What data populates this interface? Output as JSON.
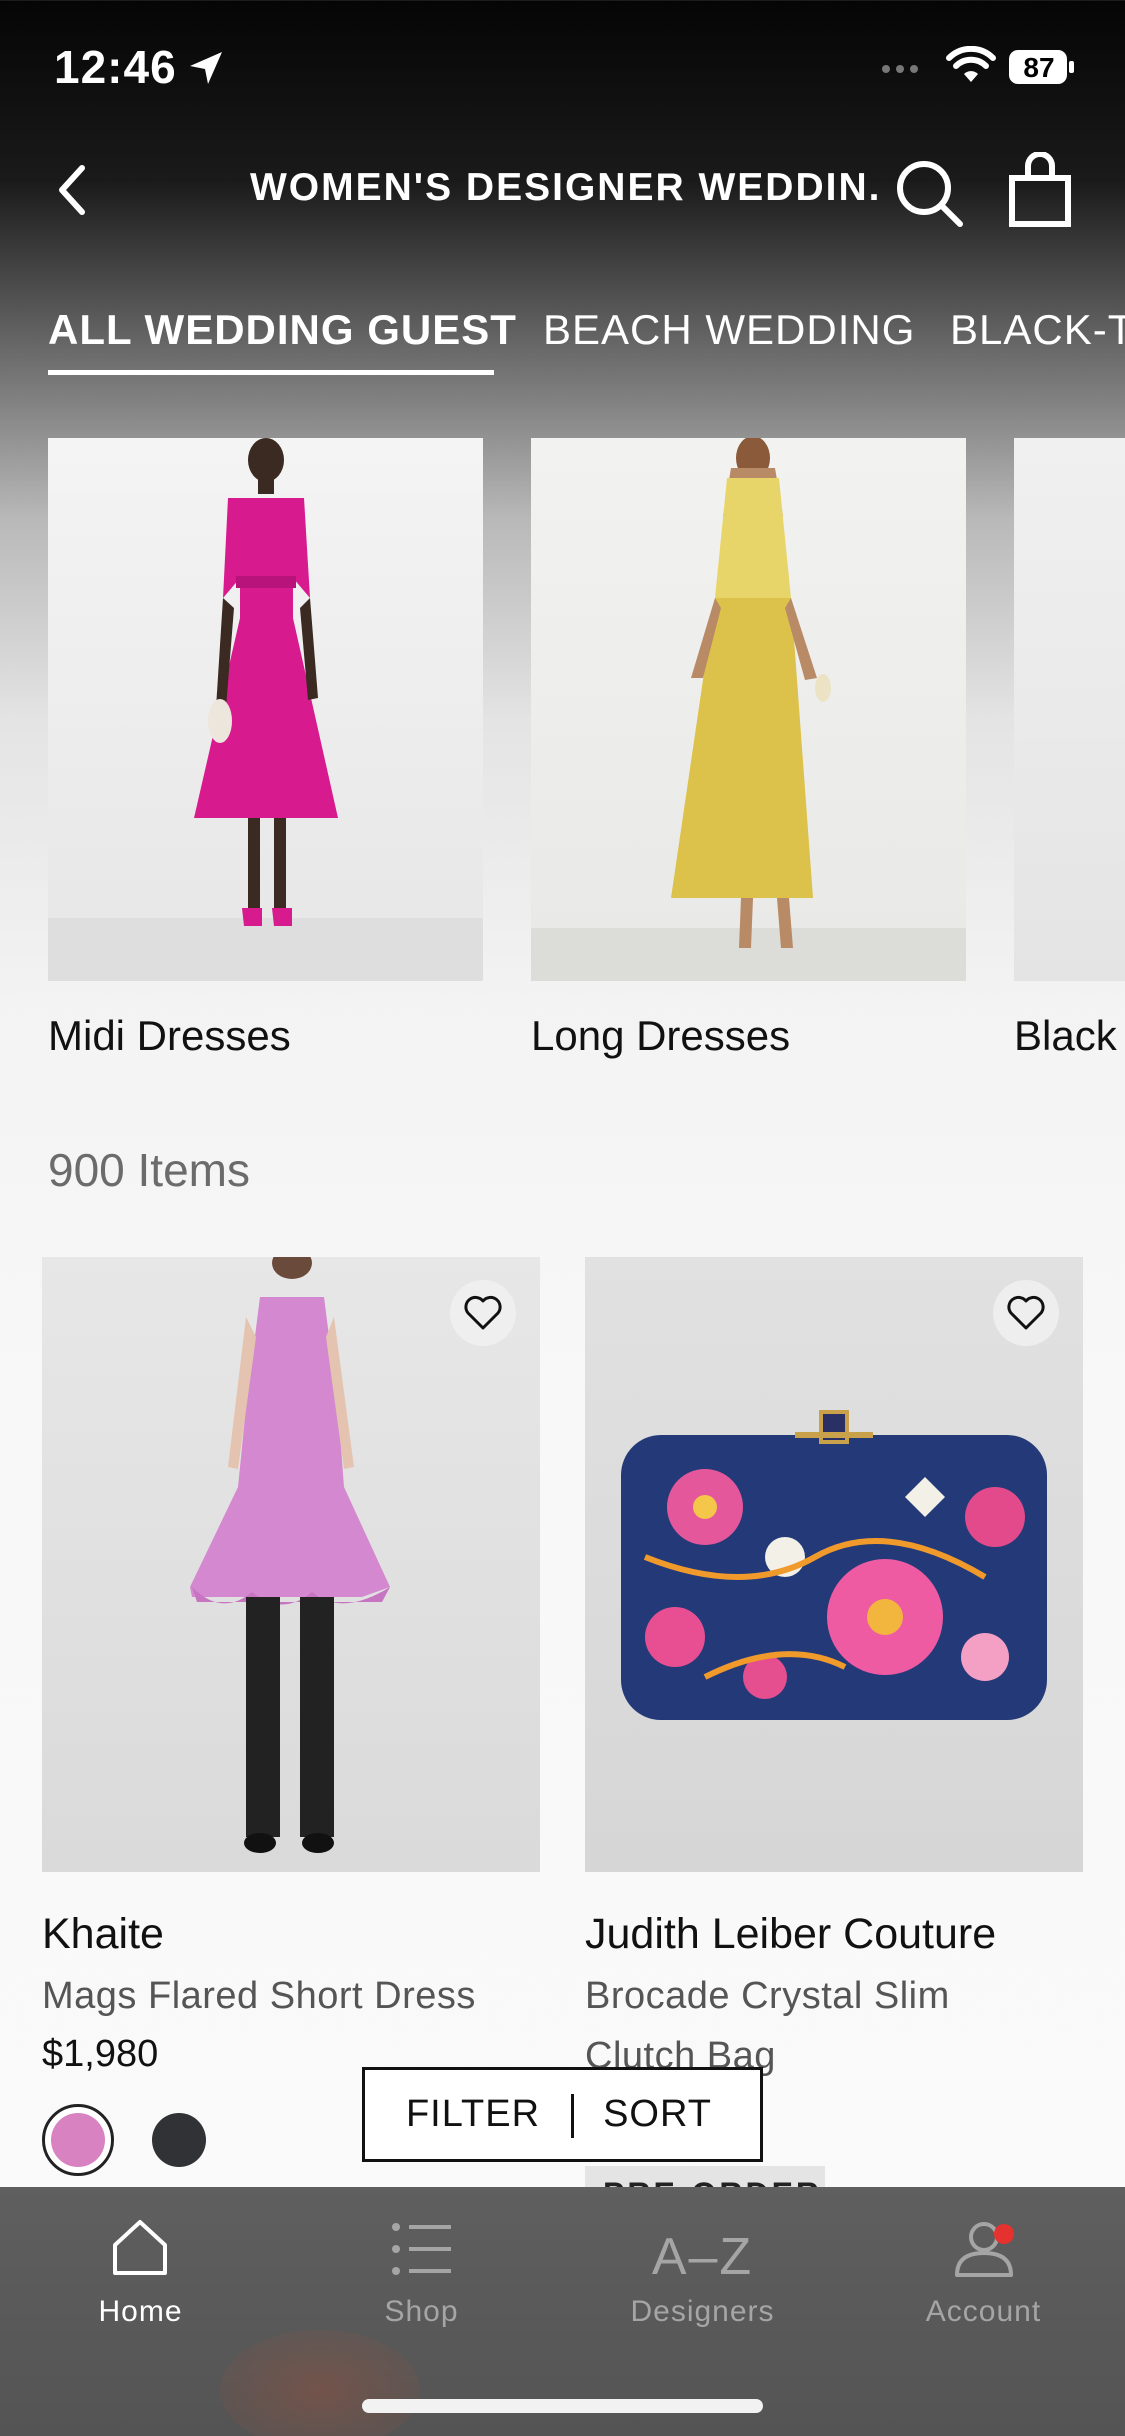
{
  "status_bar": {
    "time": "12:46",
    "battery": "87"
  },
  "header": {
    "title": "WOMEN'S DESIGNER WEDDIN..."
  },
  "tabs": [
    {
      "label": "ALL WEDDING GUEST",
      "active": true
    },
    {
      "label": "BEACH WEDDING",
      "active": false
    },
    {
      "label": "BLACK-TI",
      "active": false
    }
  ],
  "categories": [
    {
      "label": "Midi Dresses"
    },
    {
      "label": "Long Dresses"
    },
    {
      "label": "Black"
    }
  ],
  "items_count": "900 Items",
  "products": [
    {
      "brand": "Khaite",
      "name": "Mags Flared Short Dress",
      "price": "$1,980",
      "swatches": [
        "#d982c2",
        "#303236"
      ]
    },
    {
      "brand": "Judith Leiber Couture",
      "name_line1": "Brocade Crystal Slim",
      "name_line2": "Clutch Bag",
      "badge": "PRE-ORDER"
    }
  ],
  "filter_sort": {
    "filter_label": "FILTER",
    "sort_label": "SORT"
  },
  "bottom_nav": [
    {
      "label": "Home",
      "icon": "home-icon",
      "active": true
    },
    {
      "label": "Shop",
      "icon": "list-icon",
      "active": false
    },
    {
      "label": "Designers",
      "icon": "az-icon",
      "glyph": "A–Z",
      "active": false
    },
    {
      "label": "Account",
      "icon": "account-icon",
      "active": false,
      "has_badge": true
    }
  ],
  "colors": {
    "accent_badge": "#e5322f",
    "nav_bg": "#5a5a5a"
  }
}
